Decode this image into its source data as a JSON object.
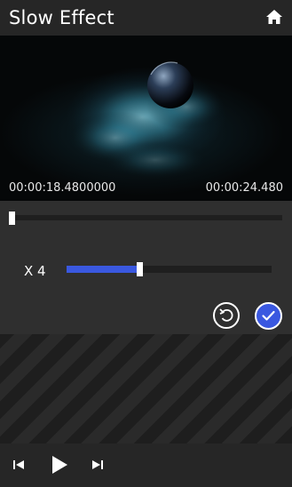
{
  "header": {
    "title": "Slow Effect",
    "home_icon": "home-icon"
  },
  "video": {
    "current_time": "00:00:18.4800000",
    "end_time": "00:00:24.480"
  },
  "seek": {
    "position": 0.0
  },
  "speed": {
    "label": "X 4",
    "value": 0.34
  },
  "actions": {
    "reset_icon": "undo-icon",
    "apply_icon": "check-icon"
  },
  "playback": {
    "prev_icon": "skip-previous-icon",
    "play_icon": "play-icon",
    "next_icon": "skip-next-icon"
  },
  "colors": {
    "accent": "#3a58e0",
    "header_bg": "#262626",
    "panel_bg": "#2f2f2f"
  }
}
